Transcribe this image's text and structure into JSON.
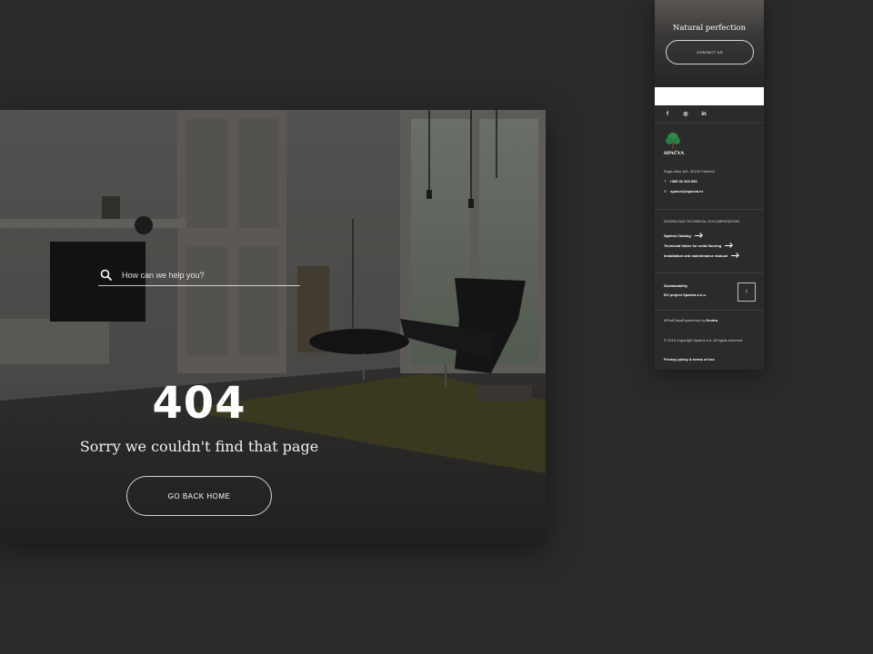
{
  "desktop": {
    "search": {
      "placeholder": "How can we help you?"
    },
    "error_code": "404",
    "message": "Sorry we couldn't find that page",
    "home_button": "GO BACK HOME"
  },
  "mobile": {
    "hero": {
      "title": "Natural perfection",
      "contact_button": "CONTACT US"
    },
    "socials": [
      {
        "icon": "facebook-icon",
        "glyph": "f"
      },
      {
        "icon": "instagram-icon",
        "glyph": "◎"
      },
      {
        "icon": "linkedin-icon",
        "glyph": "in"
      }
    ],
    "logo_text": "SPAČVA",
    "address": "Duga ulica 181, 32100 Vinkovci",
    "phone_label": "T:",
    "phone": "+385 32 303 066",
    "email_label": "E:",
    "email": "spacva@spacva.hr",
    "docs_heading": "DOWNLOAD TECHNICAL DOCUMENTATION",
    "docs": [
      "Spačva Catalog",
      "Technical folder for solid flooring",
      "Installation and maintenance manual"
    ],
    "sustainability": "Sustainability",
    "eu_project": "EU project Spačva d.o.o.",
    "experience_prefix": "#FirstClassExperience by",
    "experience_brand": "Kentra",
    "copyright": "© 2019 Copyright Spačva d.d. All rights reserved",
    "privacy": "Privacy policy & terms of use",
    "colors": {
      "background": "#2a2a2a",
      "panel": "#2b2b2b",
      "logo_green": "#2f8b4a"
    }
  }
}
